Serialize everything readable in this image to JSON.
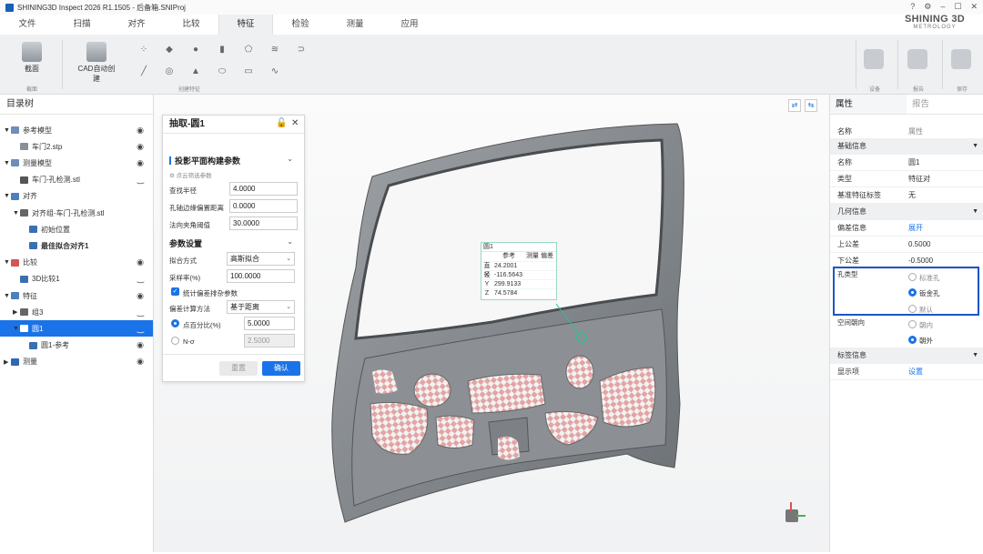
{
  "window": {
    "title": "SHINING3D Inspect 2026 R1.1505 - 后备箱.SNIProj"
  },
  "logo": {
    "line1": "SHINING 3D",
    "line2": "METROLOGY"
  },
  "menu": [
    "文件",
    "扫描",
    "对齐",
    "比较",
    "特征",
    "检验",
    "测量",
    "应用"
  ],
  "menu_active_index": 4,
  "ribbon": {
    "section_btn": "截面",
    "section_group": "截面",
    "cad_btn": "CAD自动创建",
    "feature_group": "创建特征",
    "device_group": "设备",
    "report_group": "报告",
    "save_group": "保存"
  },
  "left_panel": {
    "title": "目录树",
    "items": [
      {
        "label": "参考模型",
        "level": 0,
        "tri": "▼",
        "icon": "cube-stack-icon",
        "eye": "open"
      },
      {
        "label": "车门2.stp",
        "level": 1,
        "tri": "",
        "icon": "cad-model-icon",
        "eye": "open"
      },
      {
        "label": "测量模型",
        "level": 0,
        "tri": "▼",
        "icon": "cube-stack-icon",
        "eye": "open"
      },
      {
        "label": "车门-孔检测.stl",
        "level": 1,
        "tri": "",
        "icon": "mesh-model-icon",
        "eye": "closed"
      },
      {
        "label": "对齐",
        "level": 0,
        "tri": "▼",
        "icon": "align-icon",
        "eye": ""
      },
      {
        "label": "对齐组-车门-孔检测.stl",
        "level": 1,
        "tri": "▼",
        "icon": "folder-icon",
        "eye": ""
      },
      {
        "label": "初始位置",
        "level": 2,
        "tri": "",
        "icon": "align-result-icon",
        "eye": ""
      },
      {
        "label": "最佳拟合对齐1",
        "level": 2,
        "tri": "",
        "icon": "align-result-icon",
        "eye": "",
        "bold": true
      },
      {
        "label": "比较",
        "level": 0,
        "tri": "▼",
        "icon": "compare-icon",
        "eye": "open"
      },
      {
        "label": "3D比较1",
        "level": 1,
        "tri": "",
        "icon": "compare-3d-icon",
        "eye": "closed"
      },
      {
        "label": "特征",
        "level": 0,
        "tri": "▼",
        "icon": "feature-icon",
        "eye": "open"
      },
      {
        "label": "组3",
        "level": 1,
        "tri": "▶",
        "icon": "folder-icon",
        "eye": "closed"
      },
      {
        "label": "圆1",
        "level": 1,
        "tri": "▼",
        "icon": "circle-feature-icon",
        "eye": "closed",
        "selected": true
      },
      {
        "label": "圆1-参考",
        "level": 2,
        "tri": "",
        "icon": "circle-feature-icon",
        "eye": "open"
      },
      {
        "label": "测量",
        "level": 0,
        "tri": "▶",
        "icon": "measure-icon",
        "eye": "open"
      }
    ]
  },
  "dialog": {
    "title": "抽取-圆1",
    "section1": "投影平面构建参数",
    "hint": "点云筛选参数",
    "fields": [
      {
        "label": "查找半径",
        "value": "4.0000"
      },
      {
        "label": "孔轴边缘偏置距离",
        "value": "0.0000"
      },
      {
        "label": "法向夹角阈值",
        "value": "30.0000"
      }
    ],
    "section2": "参数设置",
    "fit_label": "拟合方式",
    "fit_value": "高斯拟合",
    "sample_label": "采样率(%)",
    "sample_value": "100.0000",
    "stats_label": "统计偏差排杂参数",
    "dev_method_label": "偏差计算方法",
    "dev_method_value": "基于距离",
    "percent_label": "点百分比(%)",
    "percent_value": "5.0000",
    "nsigma_label": "N-σ",
    "nsigma_value": "2.5000",
    "reset": "重置",
    "confirm": "确认"
  },
  "annotation": {
    "title": "圆1",
    "cols": [
      "",
      "参考",
      "测量",
      "偏差"
    ],
    "rows": [
      {
        "k": "直径",
        "ref": "24.2001"
      },
      {
        "k": "X",
        "ref": "-116.5643"
      },
      {
        "k": "Y",
        "ref": "299.9133"
      },
      {
        "k": "Z",
        "ref": "74.5784"
      }
    ]
  },
  "right_panel": {
    "tab_props": "属性",
    "tab_report": "报告",
    "col_name": "名称",
    "col_attr": "属性",
    "basic_header": "基础信息",
    "name_k": "名称",
    "name_v": "圆1",
    "type_k": "类型",
    "type_v": "特征对",
    "base_k": "基准特征标签",
    "base_v": "无",
    "geo_header": "几何信息",
    "devinfo_k": "偏差信息",
    "devinfo_v": "展开",
    "upper_k": "上公差",
    "upper_v": "0.5000",
    "lower_k": "下公差",
    "lower_v": "-0.5000",
    "hole_type_k": "孔类型",
    "hole_types": [
      "标准孔",
      "钣金孔",
      "默认"
    ],
    "hole_selected": 1,
    "orient_k": "空间朝向",
    "orients": [
      "朝内",
      "朝外"
    ],
    "orient_selected": 1,
    "label_header": "标签信息",
    "display_k": "显示项",
    "display_v": "设置"
  },
  "colors": {
    "accent": "#1a73e8",
    "highlight_box": "#1a56c7",
    "panel_gray": "#eef0f2"
  }
}
